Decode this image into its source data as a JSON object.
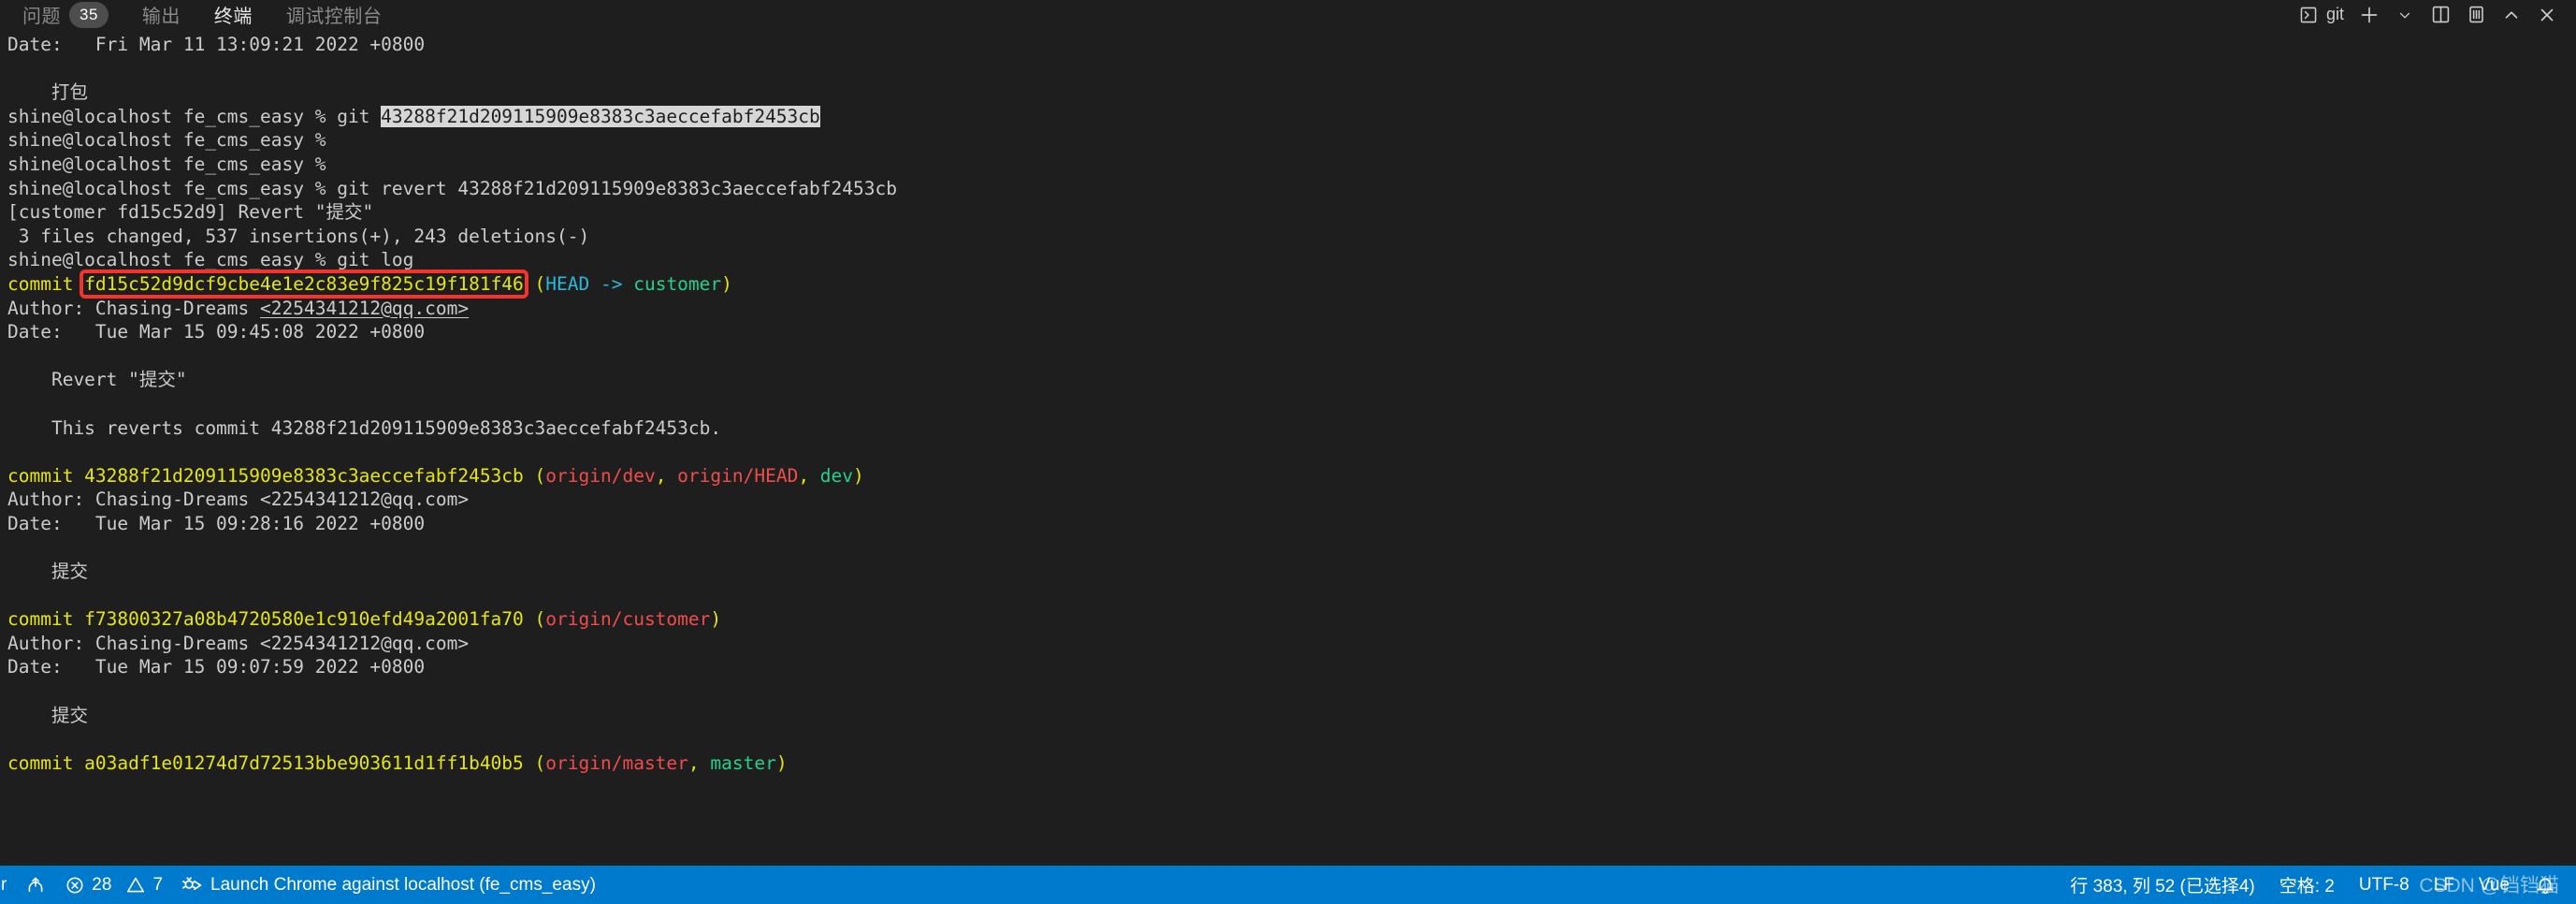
{
  "panel": {
    "tabs": [
      {
        "label": "问题",
        "badge": "35",
        "active": false
      },
      {
        "label": "输出",
        "badge": "",
        "active": false
      },
      {
        "label": "终端",
        "badge": "",
        "active": true
      },
      {
        "label": "调试控制台",
        "badge": "",
        "active": false
      }
    ],
    "actions": {
      "terminal_name": "git",
      "terminal_icon": "terminal-chevron-icon",
      "new_terminal_icon": "plus-icon",
      "new_terminal_dropdown_icon": "chevron-down-icon",
      "split_terminal_icon": "split-panel-icon",
      "kill_terminal_icon": "trash-icon",
      "maximize_panel_icon": "chevron-up-icon",
      "close_panel_icon": "close-icon"
    }
  },
  "terminal": {
    "lines": [
      {
        "segments": [
          {
            "text": "Date:   Fri Mar 11 13:09:21 2022 +0800",
            "style": "default"
          }
        ]
      },
      {
        "segments": []
      },
      {
        "segments": [
          {
            "text": "    打包",
            "style": "default"
          }
        ]
      },
      {
        "segments": [
          {
            "text": "shine@localhost fe_cms_easy % git ",
            "style": "default"
          },
          {
            "text": "43288f21d209115909e8383c3aeccefabf2453cb",
            "style": "selected"
          }
        ]
      },
      {
        "segments": [
          {
            "text": "shine@localhost fe_cms_easy % ",
            "style": "default"
          }
        ]
      },
      {
        "segments": [
          {
            "text": "shine@localhost fe_cms_easy % ",
            "style": "default"
          }
        ]
      },
      {
        "segments": [
          {
            "text": "shine@localhost fe_cms_easy % git revert 43288f21d209115909e8383c3aeccefabf2453cb",
            "style": "default"
          }
        ]
      },
      {
        "segments": [
          {
            "text": "[customer fd15c52d9] Revert \"提交\"",
            "style": "default"
          }
        ]
      },
      {
        "segments": [
          {
            "text": " 3 files changed, 537 insertions(+), 243 deletions(-)",
            "style": "default"
          }
        ]
      },
      {
        "segments": [
          {
            "text": "shine@localhost fe_cms_easy % git log",
            "style": "default"
          }
        ]
      },
      {
        "segments": [
          {
            "text": "commit ",
            "style": "yellow"
          },
          {
            "text": "fd15c52d9dcf9cbe4e1e2c83e9f825c19f181f46",
            "style": "yellow"
          },
          {
            "text": " (",
            "style": "yellow"
          },
          {
            "text": "HEAD",
            "style": "cyan"
          },
          {
            "text": " -> ",
            "style": "cyan"
          },
          {
            "text": "customer",
            "style": "green"
          },
          {
            "text": ")",
            "style": "yellow"
          }
        ]
      },
      {
        "segments": [
          {
            "text": "Author: Chasing-Dreams ",
            "style": "default"
          },
          {
            "text": "<2254341212@qq.com>",
            "style": "link"
          }
        ]
      },
      {
        "segments": [
          {
            "text": "Date:   Tue Mar 15 09:45:08 2022 +0800",
            "style": "default"
          }
        ]
      },
      {
        "segments": []
      },
      {
        "segments": [
          {
            "text": "    Revert \"提交\"",
            "style": "default"
          }
        ]
      },
      {
        "segments": []
      },
      {
        "segments": [
          {
            "text": "    This reverts commit 43288f21d209115909e8383c3aeccefabf2453cb.",
            "style": "default"
          }
        ]
      },
      {
        "segments": []
      },
      {
        "segments": [
          {
            "text": "commit 43288f21d209115909e8383c3aeccefabf2453cb ",
            "style": "yellow"
          },
          {
            "text": "(",
            "style": "yellow"
          },
          {
            "text": "origin/dev",
            "style": "red"
          },
          {
            "text": ", ",
            "style": "yellow"
          },
          {
            "text": "origin/HEAD",
            "style": "red"
          },
          {
            "text": ", ",
            "style": "yellow"
          },
          {
            "text": "dev",
            "style": "green"
          },
          {
            "text": ")",
            "style": "yellow"
          }
        ]
      },
      {
        "segments": [
          {
            "text": "Author: Chasing-Dreams <2254341212@qq.com>",
            "style": "default"
          }
        ]
      },
      {
        "segments": [
          {
            "text": "Date:   Tue Mar 15 09:28:16 2022 +0800",
            "style": "default"
          }
        ]
      },
      {
        "segments": []
      },
      {
        "segments": [
          {
            "text": "    提交",
            "style": "default"
          }
        ]
      },
      {
        "segments": []
      },
      {
        "segments": [
          {
            "text": "commit f73800327a08b4720580e1c910efd49a2001fa70 ",
            "style": "yellow"
          },
          {
            "text": "(",
            "style": "yellow"
          },
          {
            "text": "origin/customer",
            "style": "red"
          },
          {
            "text": ")",
            "style": "yellow"
          }
        ]
      },
      {
        "segments": [
          {
            "text": "Author: Chasing-Dreams <2254341212@qq.com>",
            "style": "default"
          }
        ]
      },
      {
        "segments": [
          {
            "text": "Date:   Tue Mar 15 09:07:59 2022 +0800",
            "style": "default"
          }
        ]
      },
      {
        "segments": []
      },
      {
        "segments": [
          {
            "text": "    提交",
            "style": "default"
          }
        ]
      },
      {
        "segments": []
      },
      {
        "segments": [
          {
            "text": "commit a03adf1e01274d7d72513bbe903611d1ff1b40b5 ",
            "style": "yellow"
          },
          {
            "text": "(",
            "style": "yellow"
          },
          {
            "text": "origin/master",
            "style": "red"
          },
          {
            "text": ", ",
            "style": "yellow"
          },
          {
            "text": "master",
            "style": "green"
          },
          {
            "text": ")",
            "style": "yellow"
          }
        ]
      }
    ],
    "annotation": {
      "type": "rectangle",
      "color": "#f5322b",
      "target_text": "fd15c52d9dcf9cbe4e1e2c83e9f825c19f181f46"
    }
  },
  "status_bar": {
    "background": "#007acc",
    "left": [
      {
        "icon": "",
        "label": "omer",
        "name": "branch-indicator"
      },
      {
        "icon": "sync-icon",
        "label": "",
        "name": "sync-changes"
      },
      {
        "icon": "error-icon",
        "label": "28",
        "name": "error-count"
      },
      {
        "icon": "warning-icon",
        "label": "7",
        "name": "warning-count"
      },
      {
        "icon": "debug-icon",
        "label": "Launch Chrome against localhost (fe_cms_easy)",
        "name": "debug-launch-config"
      }
    ],
    "right": [
      {
        "label": "行 383, 列 52 (已选择4)",
        "name": "editor-cursor-position"
      },
      {
        "label": "空格: 2",
        "name": "editor-indentation"
      },
      {
        "label": "UTF-8",
        "name": "editor-encoding"
      },
      {
        "label": "LF",
        "name": "editor-eol"
      },
      {
        "label": "Vue",
        "name": "editor-language-mode"
      },
      {
        "label": "",
        "icon": "bell-icon",
        "name": "notifications-bell"
      }
    ]
  },
  "watermark": {
    "text": "CSDN @铛铛猫"
  }
}
